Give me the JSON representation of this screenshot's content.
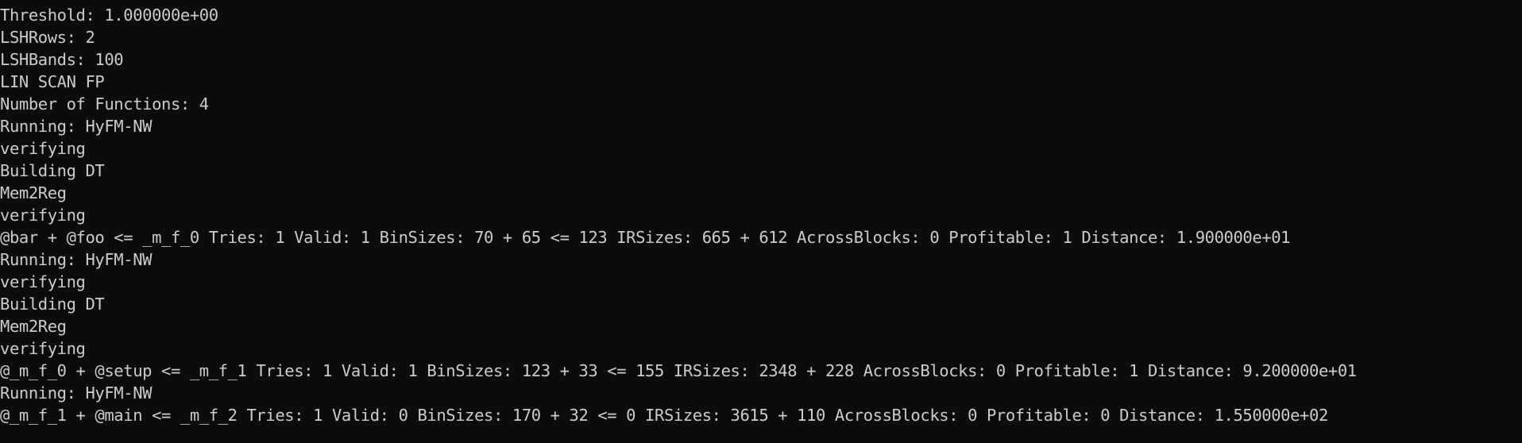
{
  "terminal": {
    "lines": [
      "Threshold: 1.000000e+00",
      "LSHRows: 2",
      "LSHBands: 100",
      "LIN SCAN FP",
      "Number of Functions: 4",
      "Running: HyFM-NW",
      "verifying",
      "Building DT",
      "Mem2Reg",
      "verifying",
      "@bar + @foo <= _m_f_0 Tries: 1 Valid: 1 BinSizes: 70 + 65 <= 123 IRSizes: 665 + 612 AcrossBlocks: 0 Profitable: 1 Distance: 1.900000e+01",
      "Running: HyFM-NW",
      "verifying",
      "Building DT",
      "Mem2Reg",
      "verifying",
      "@_m_f_0 + @setup <= _m_f_1 Tries: 1 Valid: 1 BinSizes: 123 + 33 <= 155 IRSizes: 2348 + 228 AcrossBlocks: 0 Profitable: 1 Distance: 9.200000e+01",
      "Running: HyFM-NW",
      "@_m_f_1 + @main <= _m_f_2 Tries: 1 Valid: 0 BinSizes: 170 + 32 <= 0 IRSizes: 3615 + 110 AcrossBlocks: 0 Profitable: 0 Distance: 1.550000e+02"
    ]
  }
}
